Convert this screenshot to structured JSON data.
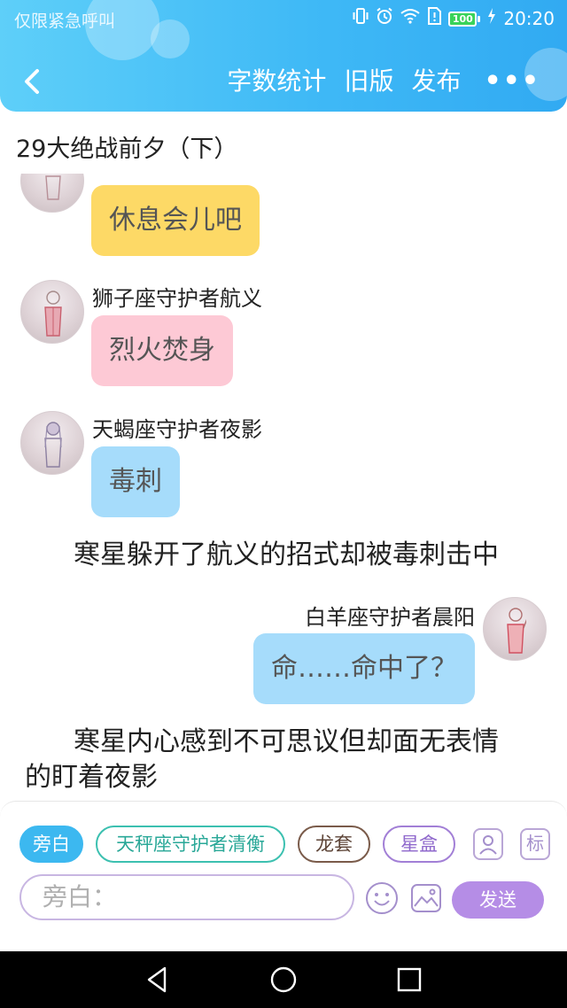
{
  "status_bar": {
    "left_text": "仅限紧急呼叫",
    "battery_level": "100",
    "time": "20:20",
    "icons": [
      "vibrate-icon",
      "alarm-icon",
      "wifi-icon",
      "sim-alert-icon",
      "battery-icon",
      "charging-icon"
    ]
  },
  "header": {
    "back_icon": "back-arrow-icon",
    "actions": [
      "字数统计",
      "旧版",
      "发布"
    ],
    "more_label": "•••"
  },
  "chapter": {
    "title": "29大绝战前夕（下）"
  },
  "messages": [
    {
      "kind": "bubble",
      "speaker": "",
      "text": "休息会儿吧",
      "bubble_color": "#fdd966"
    },
    {
      "kind": "bubble",
      "speaker": "狮子座守护者航义",
      "text": "烈火焚身",
      "bubble_color": "#fdc9d5"
    },
    {
      "kind": "bubble",
      "speaker": "天蝎座守护者夜影",
      "text": "毒刺",
      "bubble_color": "#a6dcfb"
    },
    {
      "kind": "narration",
      "text": "寒星躲开了航义的招式却被毒刺击中"
    },
    {
      "kind": "bubble",
      "speaker": "白羊座守护者晨阳",
      "text": "命……命中了？",
      "bubble_color": "#a6dcfb"
    },
    {
      "kind": "narration",
      "text_line1": "寒星内心感到不可思议但却面无表情",
      "text_line2": "的盯着夜影"
    }
  ],
  "composer": {
    "roles": [
      {
        "label": "旁白",
        "selected": true,
        "color": "#3cb8f0"
      },
      {
        "label": "天秤座守护者清衡",
        "selected": false,
        "color": "#3cc0b0"
      },
      {
        "label": "龙套",
        "selected": false,
        "color": "#7a5b4a"
      },
      {
        "label": "星盒",
        "selected": false,
        "color": "#a27fd6"
      }
    ],
    "role_card_icon": "role-card-icon",
    "tag_label": "标",
    "input_placeholder": "旁白：",
    "emoji_icon": "emoji-icon",
    "image_icon": "image-icon",
    "send_label": "发送"
  },
  "nav_bar": {
    "icons": [
      "nav-back-icon",
      "nav-home-icon",
      "nav-recent-icon"
    ]
  }
}
